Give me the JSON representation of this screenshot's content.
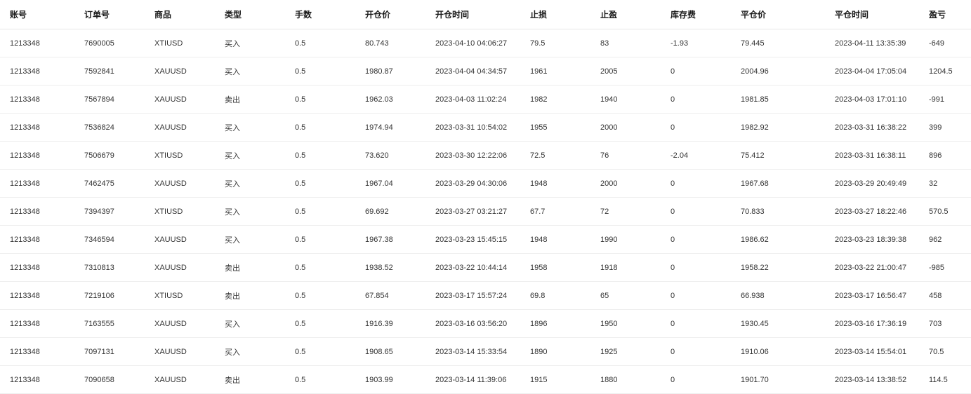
{
  "table": {
    "columns": [
      "账号",
      "订单号",
      "商品",
      "类型",
      "手数",
      "开仓价",
      "开仓时间",
      "止损",
      "止盈",
      "库存费",
      "平仓价",
      "平仓时间",
      "盈亏"
    ],
    "rows": [
      [
        "1213348",
        "7690005",
        "XTIUSD",
        "买入",
        "0.5",
        "80.743",
        "2023-04-10 04:06:27",
        "79.5",
        "83",
        "-1.93",
        "79.445",
        "2023-04-11 13:35:39",
        "-649"
      ],
      [
        "1213348",
        "7592841",
        "XAUUSD",
        "买入",
        "0.5",
        "1980.87",
        "2023-04-04 04:34:57",
        "1961",
        "2005",
        "0",
        "2004.96",
        "2023-04-04 17:05:04",
        "1204.5"
      ],
      [
        "1213348",
        "7567894",
        "XAUUSD",
        "卖出",
        "0.5",
        "1962.03",
        "2023-04-03 11:02:24",
        "1982",
        "1940",
        "0",
        "1981.85",
        "2023-04-03 17:01:10",
        "-991"
      ],
      [
        "1213348",
        "7536824",
        "XAUUSD",
        "买入",
        "0.5",
        "1974.94",
        "2023-03-31 10:54:02",
        "1955",
        "2000",
        "0",
        "1982.92",
        "2023-03-31 16:38:22",
        "399"
      ],
      [
        "1213348",
        "7506679",
        "XTIUSD",
        "买入",
        "0.5",
        "73.620",
        "2023-03-30 12:22:06",
        "72.5",
        "76",
        "-2.04",
        "75.412",
        "2023-03-31 16:38:11",
        "896"
      ],
      [
        "1213348",
        "7462475",
        "XAUUSD",
        "买入",
        "0.5",
        "1967.04",
        "2023-03-29 04:30:06",
        "1948",
        "2000",
        "0",
        "1967.68",
        "2023-03-29 20:49:49",
        "32"
      ],
      [
        "1213348",
        "7394397",
        "XTIUSD",
        "买入",
        "0.5",
        "69.692",
        "2023-03-27 03:21:27",
        "67.7",
        "72",
        "0",
        "70.833",
        "2023-03-27 18:22:46",
        "570.5"
      ],
      [
        "1213348",
        "7346594",
        "XAUUSD",
        "买入",
        "0.5",
        "1967.38",
        "2023-03-23 15:45:15",
        "1948",
        "1990",
        "0",
        "1986.62",
        "2023-03-23 18:39:38",
        "962"
      ],
      [
        "1213348",
        "7310813",
        "XAUUSD",
        "卖出",
        "0.5",
        "1938.52",
        "2023-03-22 10:44:14",
        "1958",
        "1918",
        "0",
        "1958.22",
        "2023-03-22 21:00:47",
        "-985"
      ],
      [
        "1213348",
        "7219106",
        "XTIUSD",
        "卖出",
        "0.5",
        "67.854",
        "2023-03-17 15:57:24",
        "69.8",
        "65",
        "0",
        "66.938",
        "2023-03-17 16:56:47",
        "458"
      ],
      [
        "1213348",
        "7163555",
        "XAUUSD",
        "买入",
        "0.5",
        "1916.39",
        "2023-03-16 03:56:20",
        "1896",
        "1950",
        "0",
        "1930.45",
        "2023-03-16 17:36:19",
        "703"
      ],
      [
        "1213348",
        "7097131",
        "XAUUSD",
        "买入",
        "0.5",
        "1908.65",
        "2023-03-14 15:33:54",
        "1890",
        "1925",
        "0",
        "1910.06",
        "2023-03-14 15:54:01",
        "70.5"
      ],
      [
        "1213348",
        "7090658",
        "XAUUSD",
        "卖出",
        "0.5",
        "1903.99",
        "2023-03-14 11:39:06",
        "1915",
        "1880",
        "0",
        "1901.70",
        "2023-03-14 13:38:52",
        "114.5"
      ]
    ]
  }
}
